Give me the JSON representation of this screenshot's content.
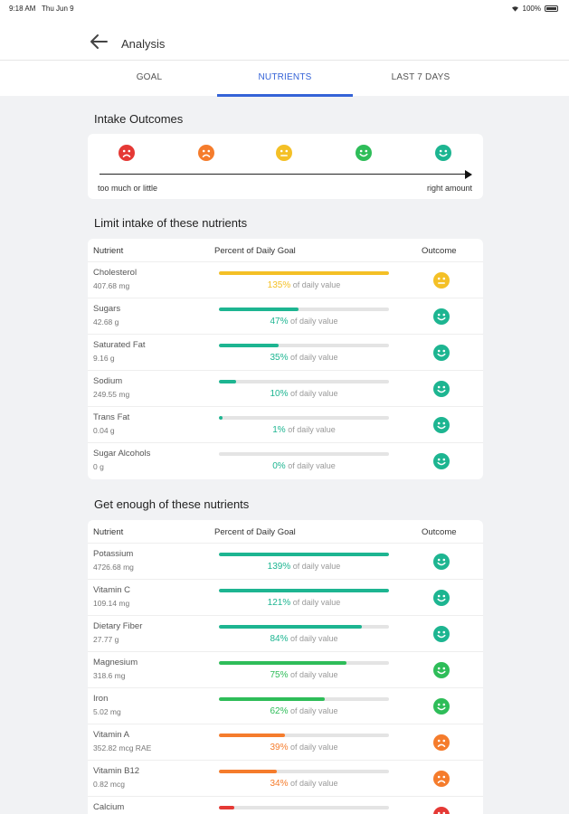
{
  "status": {
    "time": "9:18 AM",
    "date": "Thu Jun 9",
    "battery": "100%"
  },
  "header": {
    "title": "Analysis"
  },
  "tabs": [
    {
      "label": "GOAL"
    },
    {
      "label": "NUTRIENTS"
    },
    {
      "label": "LAST 7 DAYS"
    }
  ],
  "intake": {
    "title": "Intake Outcomes",
    "left_label": "too much or little",
    "right_label": "right amount",
    "faces": [
      {
        "icon": "frown-face-icon",
        "color": "#e53935"
      },
      {
        "icon": "frown-face-icon",
        "color": "#f57c2c"
      },
      {
        "icon": "neutral-face-icon",
        "color": "#f4c026"
      },
      {
        "icon": "smile-face-icon",
        "color": "#2ebd59"
      },
      {
        "icon": "smile-face-icon",
        "color": "#1db591"
      }
    ]
  },
  "table_headers": {
    "nutrient": "Nutrient",
    "percent": "Percent of Daily Goal",
    "outcome": "Outcome"
  },
  "pct_suffix": "of daily value",
  "limit": {
    "title": "Limit intake of these nutrients",
    "rows": [
      {
        "name": "Cholesterol",
        "amount": "407.68 mg",
        "percent_text": "135%",
        "percent": 135,
        "color": "#f4c026",
        "face": "neutral"
      },
      {
        "name": "Sugars",
        "amount": "42.68 g",
        "percent_text": "47%",
        "percent": 47,
        "color": "#1db591",
        "face": "smile"
      },
      {
        "name": "Saturated Fat",
        "amount": "9.16 g",
        "percent_text": "35%",
        "percent": 35,
        "color": "#1db591",
        "face": "smile"
      },
      {
        "name": "Sodium",
        "amount": "249.55 mg",
        "percent_text": "10%",
        "percent": 10,
        "color": "#1db591",
        "face": "smile"
      },
      {
        "name": "Trans Fat",
        "amount": "0.04 g",
        "percent_text": "1%",
        "percent": 1,
        "color": "#1db591",
        "face": "smile"
      },
      {
        "name": "Sugar Alcohols",
        "amount": "0 g",
        "percent_text": "0%",
        "percent": 0,
        "color": "#1db591",
        "face": "smile"
      }
    ]
  },
  "enough": {
    "title": "Get enough of these nutrients",
    "rows": [
      {
        "name": "Potassium",
        "amount": "4726.68 mg",
        "percent_text": "139%",
        "percent": 139,
        "color": "#1db591",
        "face": "smile"
      },
      {
        "name": "Vitamin C",
        "amount": "109.14 mg",
        "percent_text": "121%",
        "percent": 121,
        "color": "#1db591",
        "face": "smile"
      },
      {
        "name": "Dietary Fiber",
        "amount": "27.77 g",
        "percent_text": "84%",
        "percent": 84,
        "color": "#1db591",
        "face": "smile"
      },
      {
        "name": "Magnesium",
        "amount": "318.6 mg",
        "percent_text": "75%",
        "percent": 75,
        "color": "#2ebd59",
        "face": "smile"
      },
      {
        "name": "Iron",
        "amount": "5.02 mg",
        "percent_text": "62%",
        "percent": 62,
        "color": "#2ebd59",
        "face": "smile"
      },
      {
        "name": "Vitamin A",
        "amount": "352.82 mcg RAE",
        "percent_text": "39%",
        "percent": 39,
        "color": "#f57c2c",
        "face": "frown"
      },
      {
        "name": "Vitamin B12",
        "amount": "0.82 mcg",
        "percent_text": "34%",
        "percent": 34,
        "color": "#f57c2c",
        "face": "frown"
      },
      {
        "name": "Calcium",
        "amount": "",
        "percent_text": "",
        "percent": 9,
        "color": "#e53935",
        "face": "frown"
      }
    ]
  }
}
